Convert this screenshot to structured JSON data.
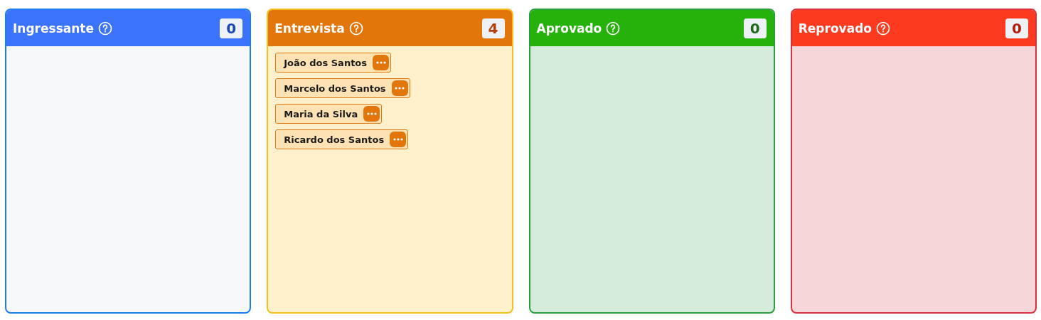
{
  "columns": [
    {
      "title": "Ingressante",
      "kind": "info",
      "count": "0"
    },
    {
      "title": "Entrevista",
      "kind": "warning",
      "count": "4",
      "cards": [
        {
          "name": "João dos Santos"
        },
        {
          "name": "Marcelo dos Santos"
        },
        {
          "name": "Maria da Silva"
        },
        {
          "name": "Ricardo dos Santos"
        }
      ]
    },
    {
      "title": "Aprovado",
      "kind": "success",
      "count": "0"
    },
    {
      "title": "Reprovado",
      "kind": "danger",
      "count": "0"
    }
  ]
}
